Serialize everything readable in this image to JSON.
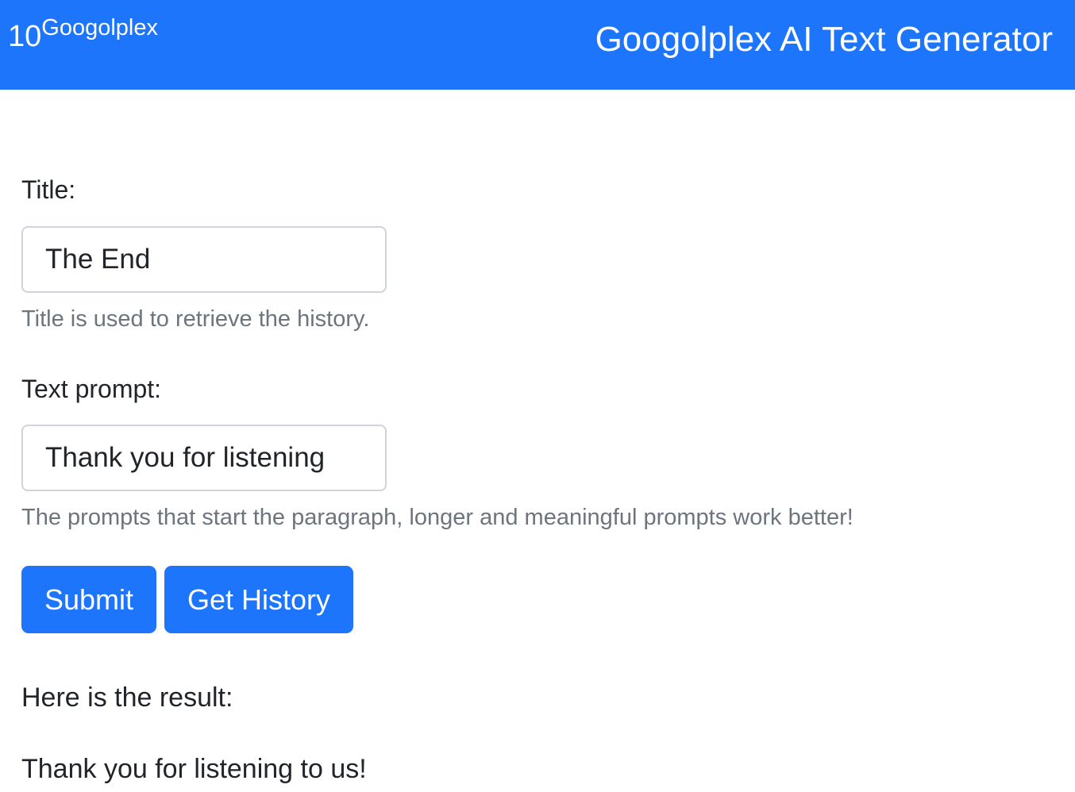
{
  "header": {
    "brand_base": "10",
    "brand_exponent": "Googolplex",
    "app_title": "Googolplex AI Text Generator"
  },
  "form": {
    "title_label": "Title:",
    "title_value": "The End",
    "title_help": "Title is used to retrieve the history.",
    "prompt_label": "Text prompt:",
    "prompt_value": "Thank you for listening",
    "prompt_help": "The prompts that start the paragraph, longer and meaningful prompts work better!",
    "submit_label": "Submit",
    "history_label": "Get History"
  },
  "result": {
    "label": "Here is the result:",
    "text": "Thank you for listening to us!"
  },
  "colors": {
    "primary": "#1c75fa",
    "muted_text": "#6c757d",
    "input_border": "#ced4da"
  }
}
